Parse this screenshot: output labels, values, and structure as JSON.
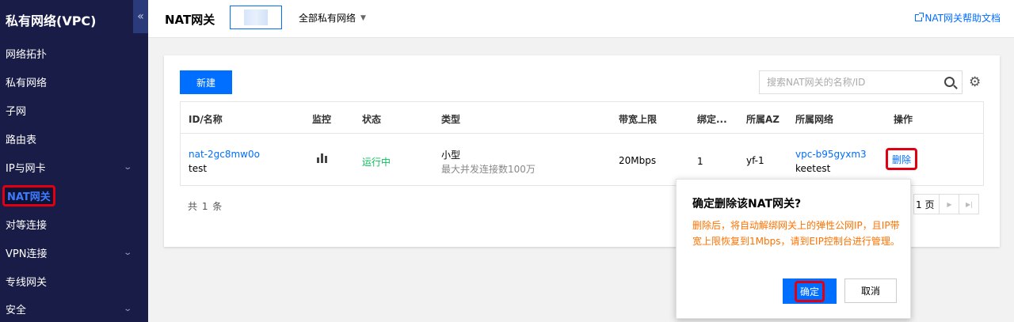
{
  "sidebar": {
    "title": "私有网络(VPC)",
    "collapse_icon": "«",
    "items": [
      {
        "label": "网络拓扑"
      },
      {
        "label": "私有网络"
      },
      {
        "label": "子网"
      },
      {
        "label": "路由表"
      },
      {
        "label": "IP与网卡",
        "chevron": "⌄"
      },
      {
        "label": "NAT网关"
      },
      {
        "label": "对等连接"
      },
      {
        "label": "VPN连接",
        "chevron": "⌄"
      },
      {
        "label": "专线网关"
      },
      {
        "label": "安全",
        "chevron": "⌄"
      }
    ]
  },
  "topbar": {
    "title": "NAT网关",
    "vpc_select": "全部私有网络",
    "help_link": "NAT网关帮助文档"
  },
  "toolbar": {
    "new_label": "新建",
    "search_placeholder": "搜索NAT网关的名称/ID"
  },
  "table": {
    "headers": {
      "id_name": "ID/名称",
      "monitor": "监控",
      "status": "状态",
      "type": "类型",
      "bandwidth": "带宽上限",
      "bound": "绑定...",
      "az": "所属AZ",
      "vpc": "所属网络",
      "actions": "操作"
    },
    "rows": [
      {
        "id": "nat-2gc8mw0o",
        "name": "test",
        "status": "运行中",
        "type": "小型",
        "type_desc": "最大并发连接数100万",
        "bandwidth": "20Mbps",
        "bound": "1",
        "az": "yf-1",
        "vpc_id": "vpc-b95gyxm3",
        "vpc_name": "keetest",
        "action_delete": "删除"
      }
    ]
  },
  "footer": {
    "total": "共 1 条",
    "page_suffix": "1 页"
  },
  "popconfirm": {
    "title": "确定删除该NAT网关?",
    "message": "删除后，将自动解绑网关上的弹性公网IP，且IP带宽上限恢复到1Mbps，请到EIP控制台进行管理。",
    "ok_label": "确定",
    "cancel_label": "取消"
  },
  "colors": {
    "sidebar_bg": "#191c46",
    "primary": "#006eff",
    "running": "#0abf5b",
    "warning_text": "#ff7200",
    "highlight_border": "#e00012"
  }
}
